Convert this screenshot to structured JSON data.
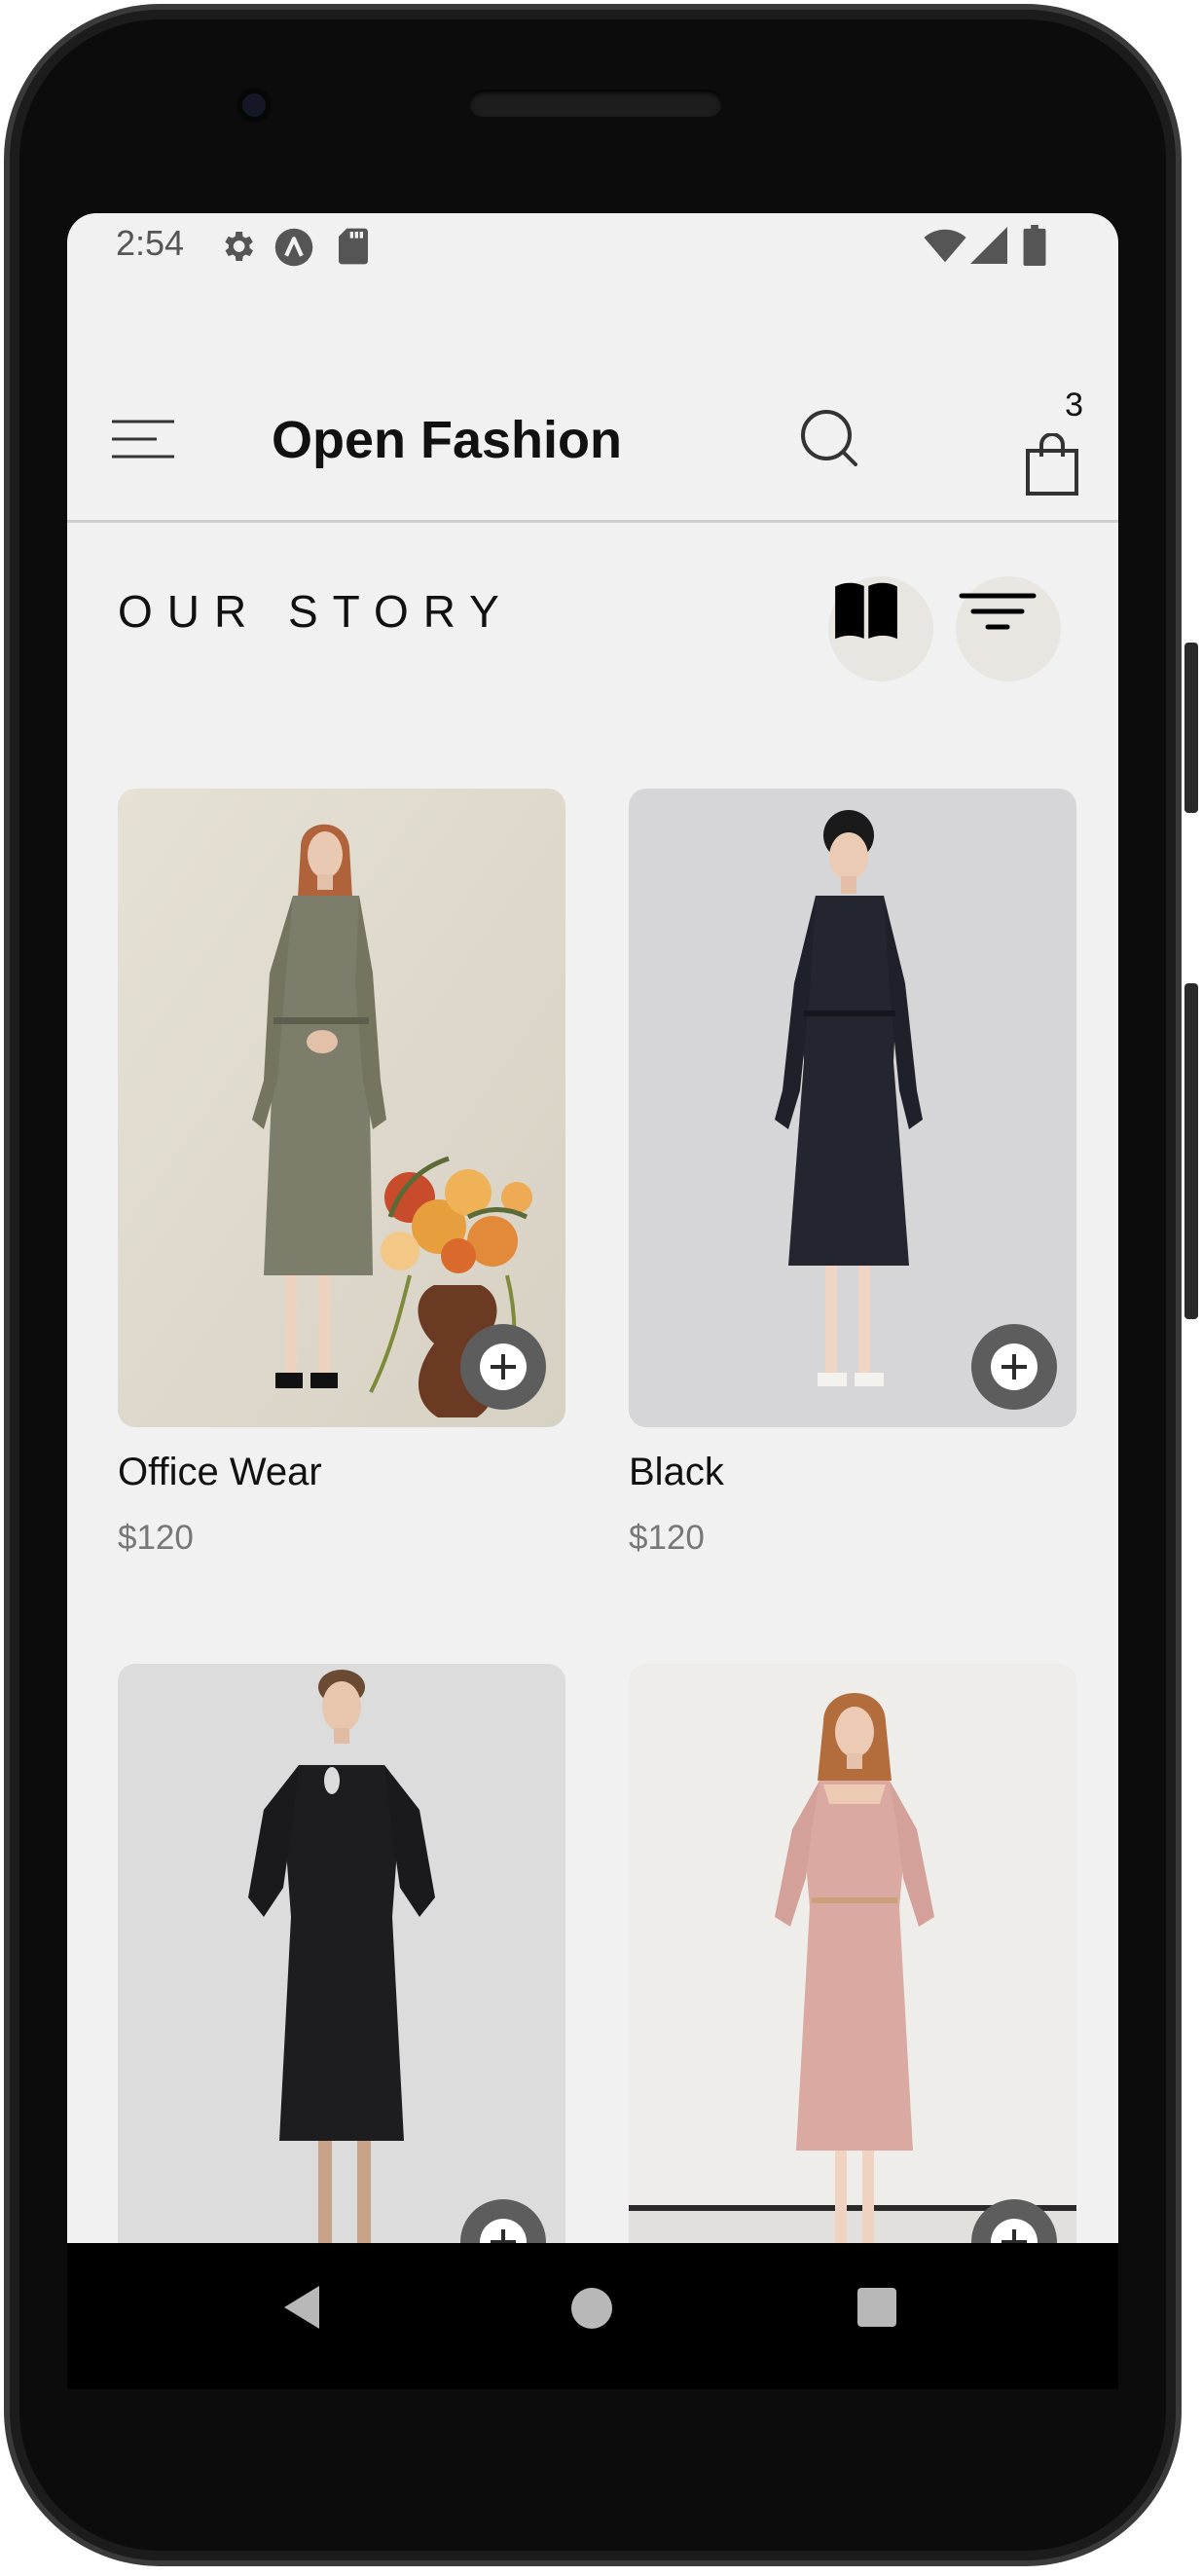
{
  "status_bar": {
    "time": "2:54",
    "icons": [
      "gear-icon",
      "a-logo-icon",
      "sd-card-icon",
      "wifi-icon",
      "cell-signal-icon",
      "battery-icon"
    ]
  },
  "header": {
    "brand": "Open Fashion",
    "cart_count": "3",
    "icons": [
      "menu-icon",
      "search-icon",
      "shopping-bag-icon"
    ]
  },
  "section": {
    "title": "OUR STORY",
    "icons": [
      "book-icon",
      "filter-icon"
    ]
  },
  "products": [
    {
      "name": "Office Wear",
      "price": "$120",
      "image": "woman in grey coat dress with flower arrangement"
    },
    {
      "name": "Black",
      "price": "$120",
      "image": "woman in dark navy coat dress"
    },
    {
      "name": "",
      "price": "",
      "image": "woman in black long-sleeve dress"
    },
    {
      "name": "",
      "price": "",
      "image": "woman in pink square-neck dress"
    }
  ],
  "colors": {
    "screen_bg": "#f1f1f1",
    "add_button": "#5d5d5d",
    "action_button_bg": "#e9e6e2",
    "text_primary": "#111111",
    "text_secondary": "#777777"
  },
  "nav_bar": {
    "icons": [
      "back-icon",
      "home-icon",
      "recents-icon"
    ]
  }
}
